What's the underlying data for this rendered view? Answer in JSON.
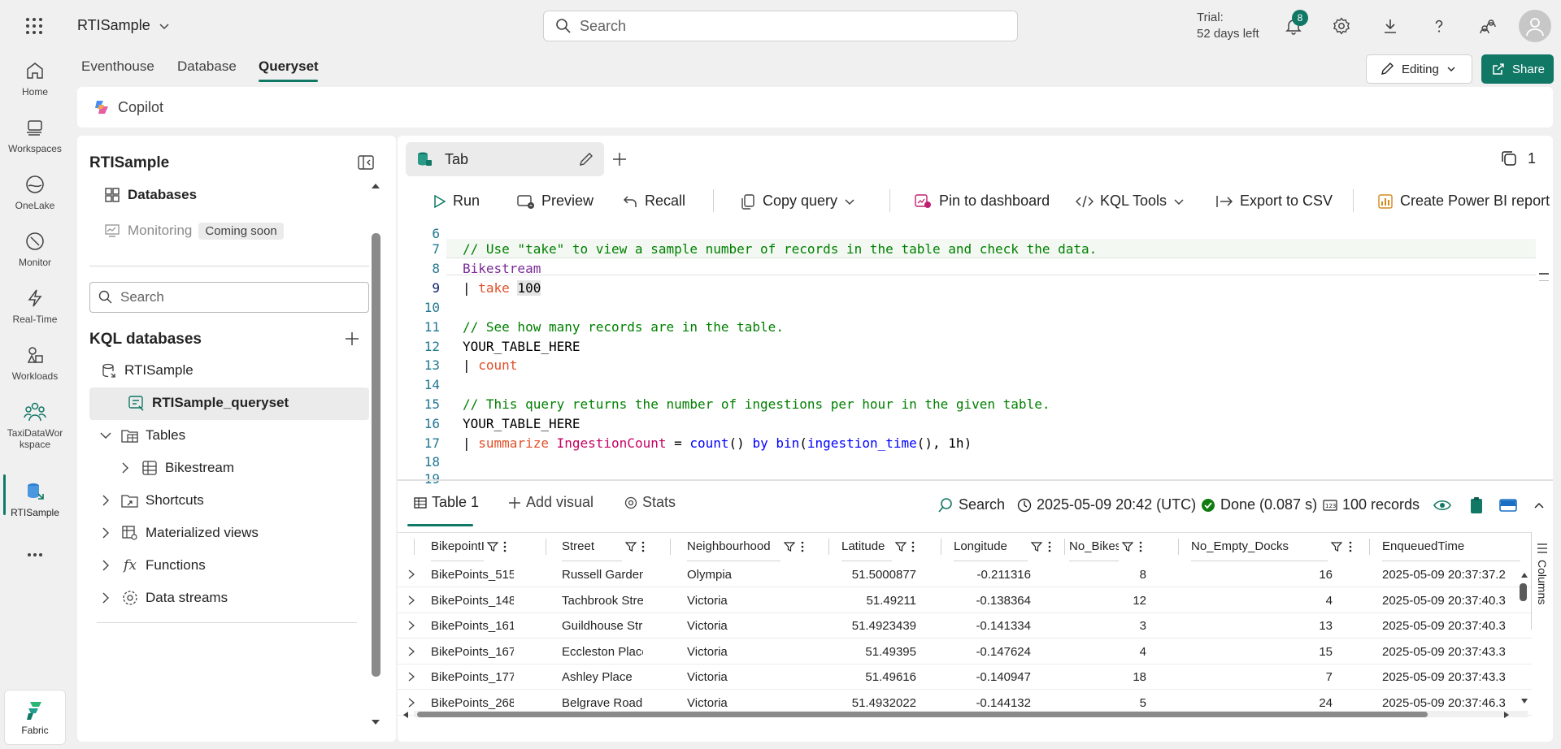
{
  "app": {
    "name": "RTISample"
  },
  "search": {
    "placeholder": "Search"
  },
  "trial": {
    "line1": "Trial:",
    "line2": "52 days left"
  },
  "notifications": {
    "count": "8"
  },
  "nav": [
    {
      "label": "Home",
      "icon": "home-icon"
    },
    {
      "label": "Workspaces",
      "icon": "workspaces-icon"
    },
    {
      "label": "OneLake",
      "icon": "onelake-icon"
    },
    {
      "label": "Monitor",
      "icon": "monitor-icon"
    },
    {
      "label": "Real-Time",
      "icon": "realtime-icon"
    },
    {
      "label": "Workloads",
      "icon": "workloads-icon"
    },
    {
      "label": "TaxiDataWor",
      "label2": "kspace",
      "icon": "workspace-people-icon"
    },
    {
      "label": "RTISample",
      "icon": "kql-database-icon"
    },
    {
      "label": "...",
      "icon": "more-icon"
    }
  ],
  "fabric": {
    "label": "Fabric"
  },
  "subtabs": {
    "eventhouse": "Eventhouse",
    "database": "Database",
    "queryset": "Queryset"
  },
  "editing": {
    "label": "Editing"
  },
  "share": {
    "label": "Share"
  },
  "copilot": {
    "label": "Copilot"
  },
  "explorer": {
    "title": "RTISample",
    "databases": "Databases",
    "monitoring": "Monitoring",
    "coming_soon": "Coming soon",
    "search_placeholder": "Search",
    "kql_header": "KQL databases",
    "db_name": "RTISample",
    "queryset_name": "RTISample_queryset",
    "tables": "Tables",
    "bikestream": "Bikestream",
    "shortcuts": "Shortcuts",
    "materialized_views": "Materialized views",
    "functions": "Functions",
    "data_streams": "Data streams"
  },
  "tab": {
    "label": "Tab",
    "count": "1"
  },
  "toolbar": {
    "run": "Run",
    "preview": "Preview",
    "recall": "Recall",
    "copy_query": "Copy query",
    "pin": "Pin to dashboard",
    "kql_tools": "KQL Tools",
    "export_csv": "Export to CSV",
    "power_bi": "Create Power BI report"
  },
  "editor": {
    "line_numbers": [
      "6",
      "7",
      "8",
      "9",
      "10",
      "11",
      "12",
      "13",
      "14",
      "15",
      "16",
      "17",
      "18",
      "19"
    ],
    "l7": "// Use \"take\" to view a sample number of records in the table and check the data.",
    "l8": "Bikestream",
    "l9_pipe": "| ",
    "l9_op": "take",
    "l9_num": "100",
    "l11": "// See how many records are in the table.",
    "l12": "YOUR_TABLE_HERE",
    "l13_pipe": "| ",
    "l13_op": "count",
    "l15": "// This query returns the number of ingestions per hour in the given table.",
    "l16": "YOUR_TABLE_HERE",
    "l17_pipe": "| ",
    "l17_op": "summarize",
    "l17_id": "IngestionCount",
    "l17_eq": " = ",
    "l17_fn1": "count",
    "l17_p1": "() ",
    "l17_by": "by",
    "l17_fn2": "bin",
    "l17_p2": "(",
    "l17_fn3": "ingestion_time",
    "l17_p3": "(), 1h)"
  },
  "results": {
    "table_tab": "Table 1",
    "add_visual": "Add visual",
    "stats": "Stats",
    "search": "Search",
    "timestamp": "2025-05-09 20:42 (UTC)",
    "status": "Done (0.087 s)",
    "records": "100 records",
    "columns_label": "Columns",
    "headers": [
      "BikepointID",
      "Street",
      "Neighbourhood",
      "Latitude",
      "Longitude",
      "No_Bikes",
      "No_Empty_Docks",
      "EnqueuedTime"
    ],
    "rows": [
      [
        "BikePoints_515",
        "Russell Gardens",
        "Olympia",
        "51.5000877",
        "-0.211316",
        "8",
        "16",
        "2025-05-09 20:37:37.2"
      ],
      [
        "BikePoints_148",
        "Tachbrook Street",
        "Victoria",
        "51.49211",
        "-0.138364",
        "12",
        "4",
        "2025-05-09 20:37:40.3"
      ],
      [
        "BikePoints_161",
        "Guildhouse Street",
        "Victoria",
        "51.4923439",
        "-0.141334",
        "3",
        "13",
        "2025-05-09 20:37:40.3"
      ],
      [
        "BikePoints_167",
        "Eccleston Place",
        "Victoria",
        "51.49395",
        "-0.147624",
        "4",
        "15",
        "2025-05-09 20:37:43.3"
      ],
      [
        "BikePoints_177",
        "Ashley Place",
        "Victoria",
        "51.49616",
        "-0.140947",
        "18",
        "7",
        "2025-05-09 20:37:43.3"
      ],
      [
        "BikePoints_268",
        "Belgrave Road",
        "Victoria",
        "51.4932022",
        "-0.144132",
        "5",
        "24",
        "2025-05-09 20:37:46.3"
      ]
    ]
  },
  "colors": {
    "accent": "#117865",
    "comment": "#008000",
    "keyword_op": "#e0502a",
    "table": "#7c2a9a",
    "function": "#0000ff"
  }
}
